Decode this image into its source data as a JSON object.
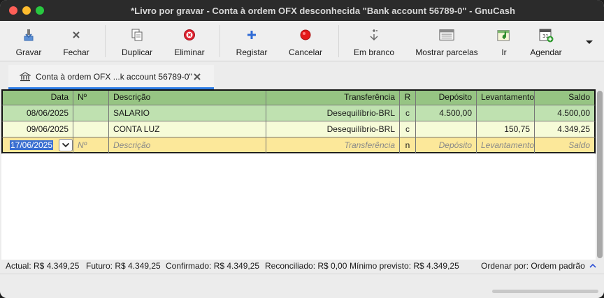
{
  "window": {
    "title": "*Livro por gravar - Conta à ordem OFX desconhecida \"Bank account 56789-0\" - GnuCash"
  },
  "toolbar": {
    "items": [
      {
        "label": "Gravar",
        "icon": "save-icon"
      },
      {
        "label": "Fechar",
        "icon": "close-icon"
      },
      {
        "label": "Duplicar",
        "icon": "duplicate-icon"
      },
      {
        "label": "Eliminar",
        "icon": "delete-icon"
      },
      {
        "label": "Registar",
        "icon": "plus-icon"
      },
      {
        "label": "Cancelar",
        "icon": "cancel-icon"
      },
      {
        "label": "Em branco",
        "icon": "blank-icon"
      },
      {
        "label": "Mostrar parcelas",
        "icon": "split-icon"
      },
      {
        "label": "Ir",
        "icon": "jump-icon"
      },
      {
        "label": "Agendar",
        "icon": "calendar-icon"
      }
    ]
  },
  "tab": {
    "label": "Conta à ordem OFX ...k account 56789-0\""
  },
  "register": {
    "columns": [
      "Data",
      "Nº",
      "Descrição",
      "Transferência",
      "R",
      "Depósito",
      "Levantamento",
      "Saldo"
    ],
    "rows": [
      {
        "date": "08/06/2025",
        "num": "",
        "description": "SALARIO",
        "transfer": "Desequilíbrio-BRL",
        "r": "c",
        "deposit": "4.500,00",
        "withdrawal": "",
        "balance": "4.500,00"
      },
      {
        "date": "09/06/2025",
        "num": "",
        "description": "CONTA LUZ",
        "transfer": "Desequilíbrio-BRL",
        "r": "c",
        "deposit": "",
        "withdrawal": "150,75",
        "balance": "4.349,25"
      }
    ],
    "blank_row": {
      "date": "17/06/2025",
      "num": "Nº",
      "description": "Descrição",
      "transfer": "Transferência",
      "r": "n",
      "deposit": "Depósito",
      "withdrawal": "Levantamento",
      "balance": "Saldo"
    }
  },
  "status": {
    "actual": "Actual: R$ 4.349,25",
    "future": "Futuro: R$ 4.349,25",
    "cleared": "Confirmado: R$ 4.349,25",
    "reconciled": "Reconciliado: R$ 0,00",
    "projected_min": "Mínimo previsto: R$ 4.349,25",
    "sort": "Ordenar por: Ordem padrão"
  },
  "colors": {
    "header_green": "#96c483",
    "row_green": "#bfe1b0",
    "row_cream": "#f6fbd8",
    "row_yellow": "#fce89a",
    "accent_blue": "#2c7be5"
  }
}
